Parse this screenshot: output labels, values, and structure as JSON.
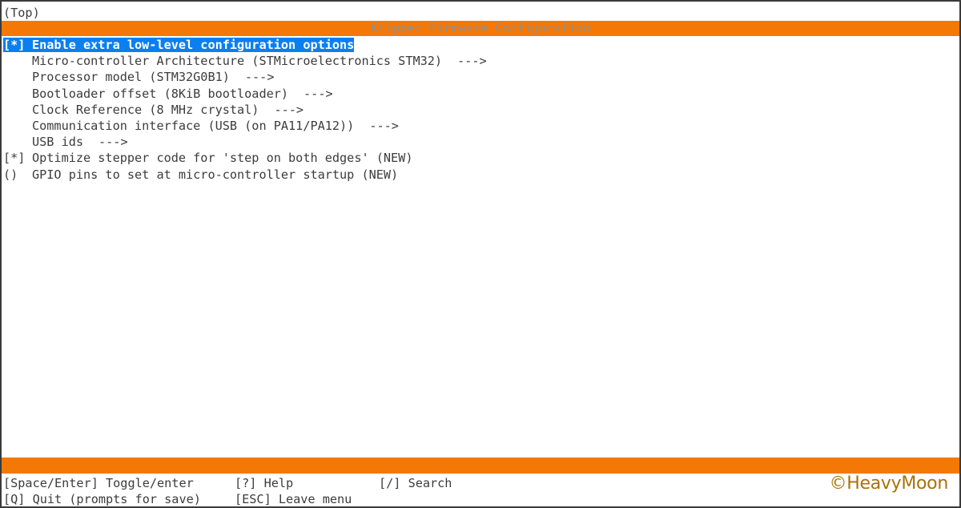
{
  "breadcrumb": "(Top)",
  "title": "Klipper Firmware Configuration",
  "menu": {
    "items": [
      {
        "prefix": "[*]",
        "label": "Enable extra low-level configuration options",
        "arrow": "",
        "selected": true
      },
      {
        "prefix": "",
        "label": "Micro-controller Architecture (STMicroelectronics STM32)",
        "arrow": "--->",
        "selected": false
      },
      {
        "prefix": "",
        "label": "Processor model (STM32G0B1)",
        "arrow": "--->",
        "selected": false
      },
      {
        "prefix": "",
        "label": "Bootloader offset (8KiB bootloader)",
        "arrow": "--->",
        "selected": false
      },
      {
        "prefix": "",
        "label": "Clock Reference (8 MHz crystal)",
        "arrow": "--->",
        "selected": false
      },
      {
        "prefix": "",
        "label": "Communication interface (USB (on PA11/PA12))",
        "arrow": "--->",
        "selected": false
      },
      {
        "prefix": "",
        "label": "USB ids",
        "arrow": "--->",
        "selected": false
      },
      {
        "prefix": "[*]",
        "label": "Optimize stepper code for 'step on both edges' (NEW)",
        "arrow": "",
        "selected": false
      },
      {
        "prefix": "()",
        "label": "GPIO pins to set at micro-controller startup (NEW)",
        "arrow": "",
        "selected": false
      }
    ]
  },
  "help": {
    "toggle": "[Space/Enter] Toggle/enter",
    "help": "[?] Help",
    "search": "[/] Search",
    "quit": "[Q] Quit (prompts for save)",
    "leave": "[ESC] Leave menu"
  },
  "watermark": "©HeavyMoon",
  "colors": {
    "accent_bar": "#f47806",
    "selection": "#0a7ff0",
    "text": "#3c3c3c",
    "watermark": "#a97208"
  }
}
